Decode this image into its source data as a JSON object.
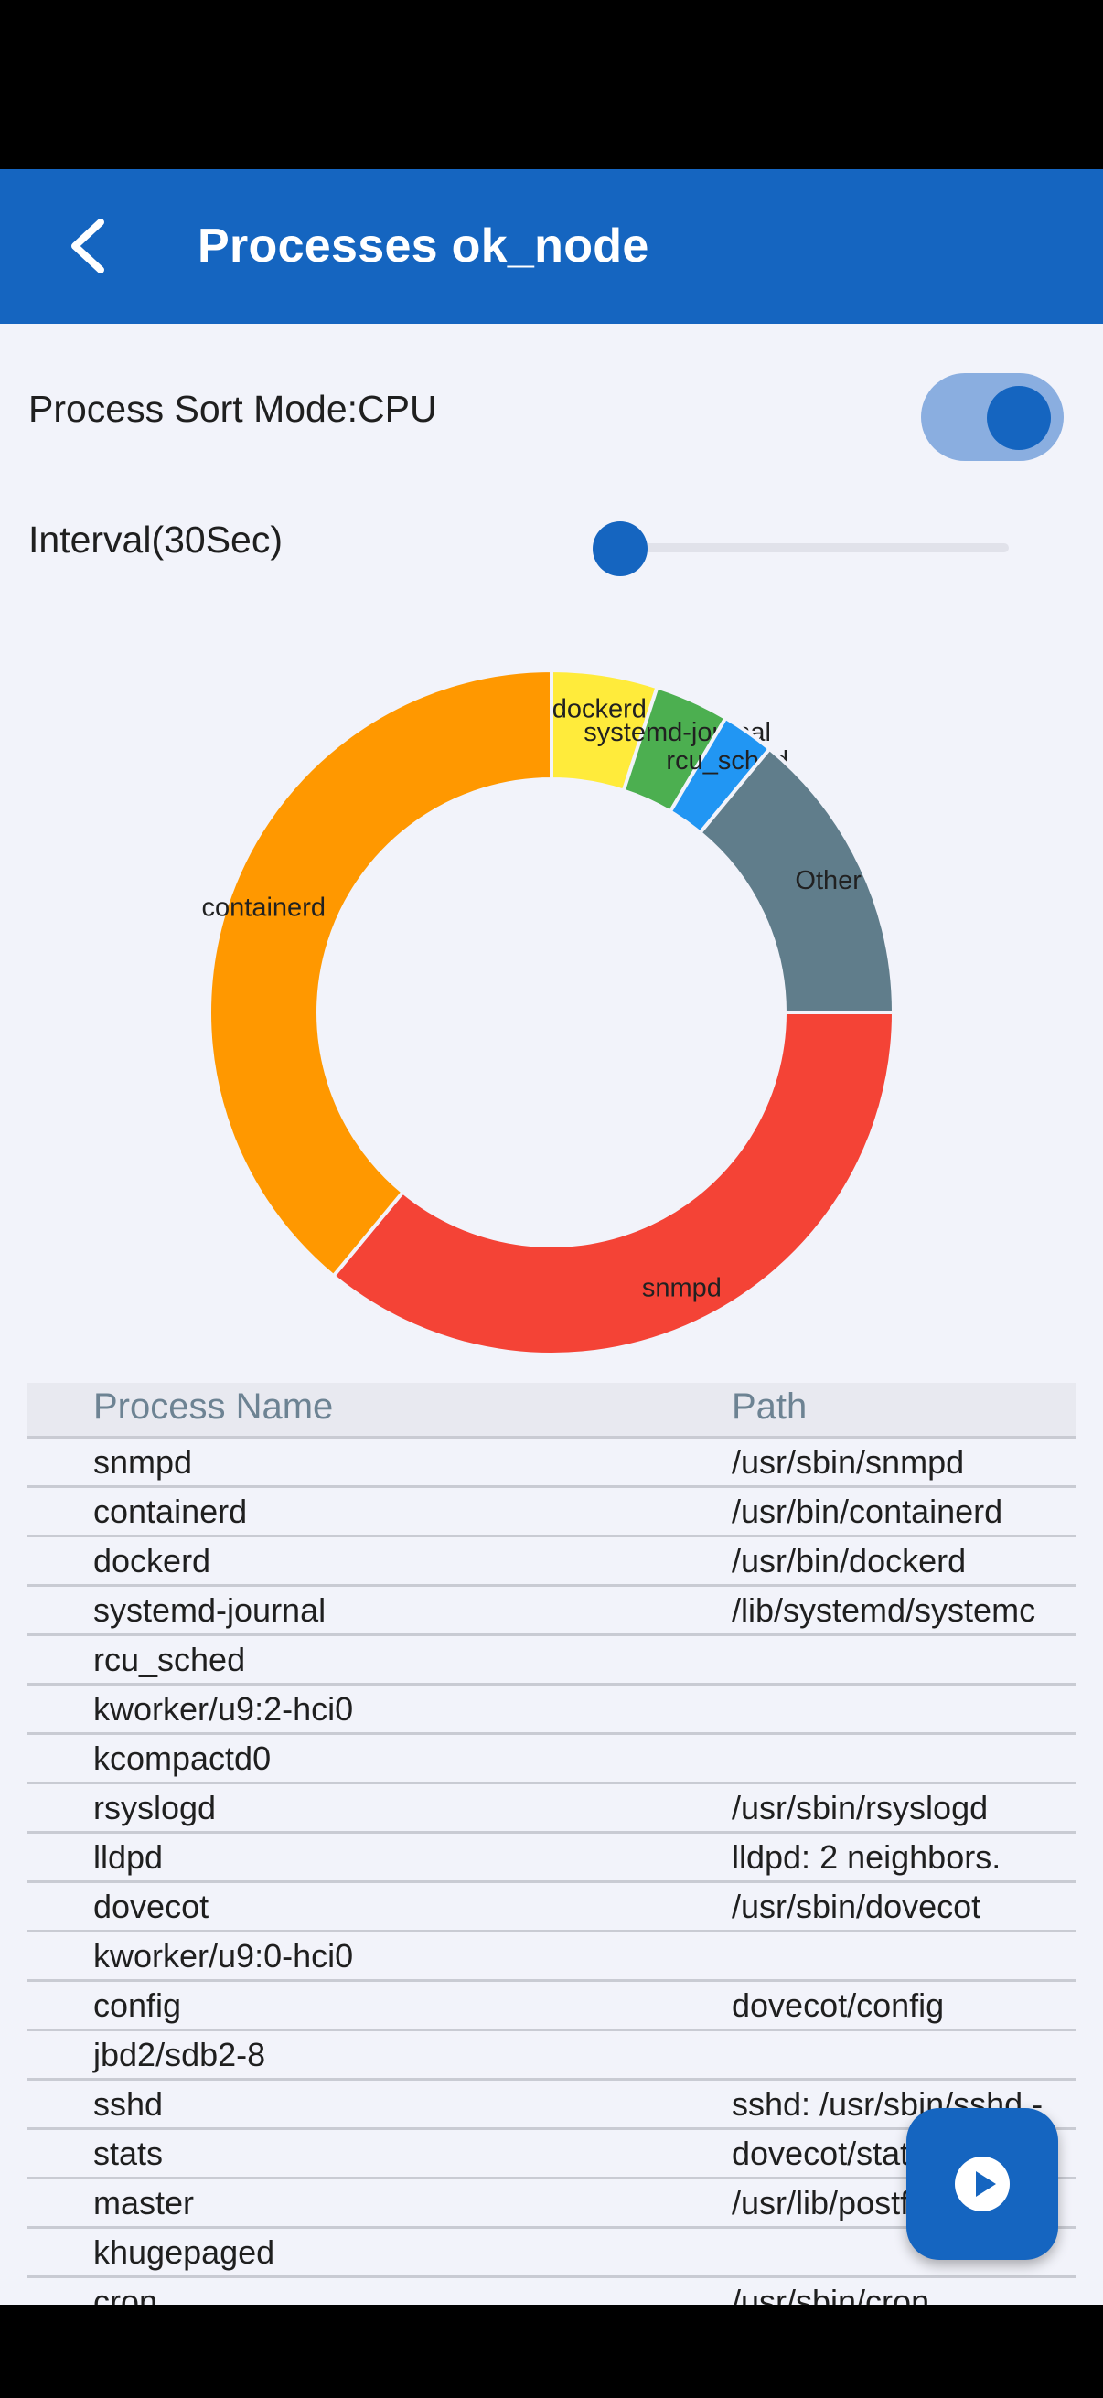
{
  "app_bar": {
    "title": "Processes ok_node",
    "back_icon": "chevron-left-icon"
  },
  "controls": {
    "sort_label": "Process Sort Mode:CPU",
    "sort_toggle_on": true,
    "interval_label": "Interval(30Sec)",
    "interval_slider_fraction": 0.0
  },
  "chart_data": {
    "type": "pie",
    "donut": true,
    "categories": [
      "dockerd",
      "systemd-journal",
      "rcu_sched",
      "Other",
      "snmpd",
      "containerd"
    ],
    "values": [
      5.0,
      3.5,
      2.5,
      14.0,
      36.0,
      39.0
    ],
    "colors": [
      "#ffeb3b",
      "#4caf50",
      "#2196f3",
      "#607d8b",
      "#f44336",
      "#ff9800"
    ],
    "title": "",
    "legend": "labels on slices"
  },
  "table": {
    "headers": [
      "Process Name",
      "Path"
    ],
    "rows": [
      {
        "name": "snmpd",
        "path": "/usr/sbin/snmpd"
      },
      {
        "name": "containerd",
        "path": "/usr/bin/containerd"
      },
      {
        "name": "dockerd",
        "path": "/usr/bin/dockerd"
      },
      {
        "name": "systemd-journal",
        "path": "/lib/systemd/systemc"
      },
      {
        "name": "rcu_sched",
        "path": ""
      },
      {
        "name": "kworker/u9:2-hci0",
        "path": ""
      },
      {
        "name": "kcompactd0",
        "path": ""
      },
      {
        "name": "rsyslogd",
        "path": "/usr/sbin/rsyslogd"
      },
      {
        "name": "lldpd",
        "path": "lldpd: 2 neighbors."
      },
      {
        "name": "dovecot",
        "path": "/usr/sbin/dovecot"
      },
      {
        "name": "kworker/u9:0-hci0",
        "path": ""
      },
      {
        "name": "config",
        "path": "dovecot/config"
      },
      {
        "name": "jbd2/sdb2-8",
        "path": ""
      },
      {
        "name": "sshd",
        "path": "sshd: /usr/sbin/sshd -"
      },
      {
        "name": "stats",
        "path": "dovecot/stats"
      },
      {
        "name": "master",
        "path": "/usr/lib/postfix/sbin/m"
      },
      {
        "name": "khugepaged",
        "path": ""
      },
      {
        "name": "cron",
        "path": "/usr/sbin/cron"
      }
    ]
  },
  "fab": {
    "icon": "play-circle-icon"
  },
  "colors": {
    "primary": "#1565c0",
    "background": "#f2f3fa",
    "header_text": "#6d8393"
  }
}
